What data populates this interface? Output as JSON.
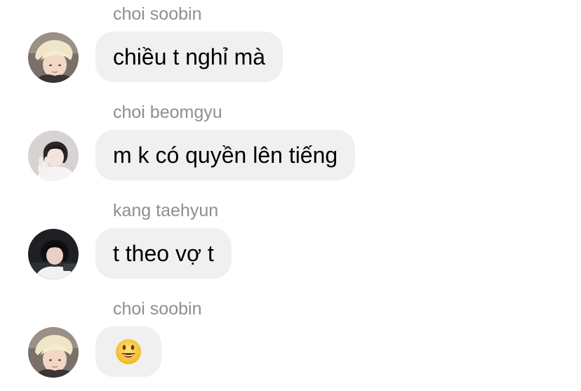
{
  "messages": [
    {
      "sender": "choi soobin",
      "avatar_icon": "avatar-soobin",
      "text": "chiều t nghỉ mà"
    },
    {
      "sender": "choi beomgyu",
      "avatar_icon": "avatar-beomgyu",
      "text": "m k có quyền lên tiếng"
    },
    {
      "sender": "kang taehyun",
      "avatar_icon": "avatar-taehyun",
      "text": "t theo vợ t"
    },
    {
      "sender": "choi soobin",
      "avatar_icon": "avatar-soobin",
      "emoji": "smiling-face-emoji"
    }
  ],
  "colors": {
    "bubble": "#f0f0f1",
    "sender_text": "#8e8e93",
    "message_text": "#000000"
  }
}
